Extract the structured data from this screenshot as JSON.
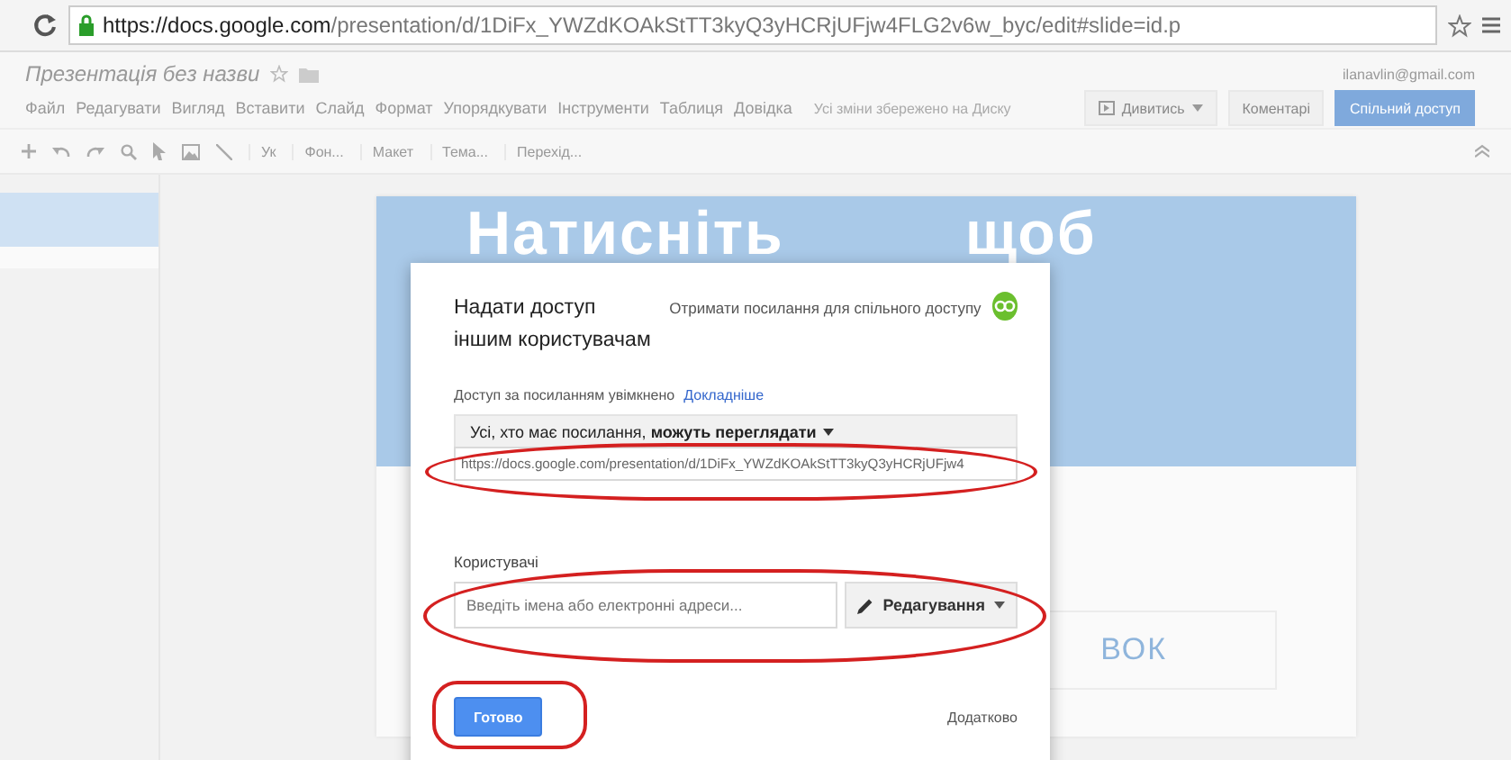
{
  "browser": {
    "url_host": "https://docs.google.com",
    "url_path": "/presentation/d/1DiFx_YWZdKOAkStTT3kyQ3yHCRjUFjw4FLG2v6w_byc/edit#slide=id.p",
    "secure": true
  },
  "app": {
    "title": "Презентація без назви",
    "account": "ilanavlin@gmail.com",
    "status": "Усі зміни збережено на Диску",
    "menu": [
      "Файл",
      "Редагувати",
      "Вигляд",
      "Вставити",
      "Слайд",
      "Формат",
      "Упорядкувати",
      "Інструменти",
      "Таблиця",
      "Довідка"
    ],
    "buttons": [
      {
        "label": "Дивитись",
        "kind": "present"
      },
      {
        "label": "Коментарі",
        "kind": "plain"
      },
      {
        "label": "Спільний доступ",
        "kind": "share"
      }
    ],
    "toolbar_texts": [
      "Ук",
      "Фон...",
      "Макет",
      "Тема...",
      "Перехід..."
    ]
  },
  "slide": {
    "title": "Натисніть щоб",
    "subtitle": "ВОК"
  },
  "dialog": {
    "heading": "Надати доступ іншим користувачам",
    "get_link": "Отримати посилання для спільного доступу",
    "link_on": true,
    "link_status": "Доступ за посиланням увімкнено",
    "learn_more": "Докладніше",
    "access": "Усі, хто має посилання, **можуть переглядати**",
    "link_url": "https://docs.google.com/presentation/d/1DiFx_YWZdKOAkStTT3kyQ3yHCRjUFjw4",
    "people_label": "Користувачі",
    "people_placeholder": "Введіть імена або електронні адреси...",
    "permission": "Редагування",
    "done": "Готово",
    "advanced": "Додатково"
  }
}
